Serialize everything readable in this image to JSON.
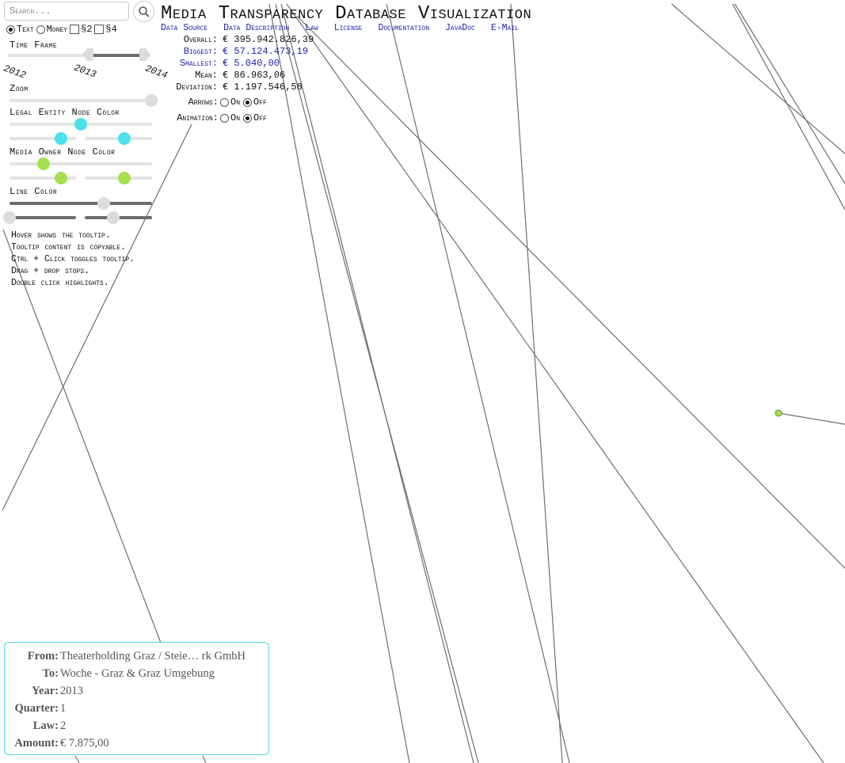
{
  "search": {
    "placeholder": "Search..."
  },
  "mode": {
    "text_label": "Text",
    "money_label": "Money",
    "para2_label": "§2",
    "para4_label": "§4",
    "selected": "text"
  },
  "sidebar": {
    "time_frame_label": "Time Frame",
    "years": [
      "2012",
      "2013",
      "2014"
    ],
    "zoom_label": "Zoom",
    "legal_entity_label": "Legal Entity Node Color",
    "media_owner_label": "Media Owner Node Color",
    "line_color_label": "Line Color",
    "colors": {
      "legal_entity": "#4be0ea",
      "media_owner": "#a6e04f",
      "slider_grey": "#dcdcdc",
      "line": "#6e6e6e"
    },
    "help_lines": [
      "Hover shows the tooltip.",
      "Tooltip content is copyable.",
      "Ctrl + Click toggles tooltip.",
      "Drag + drop stops.",
      "Double click highlights."
    ]
  },
  "header": {
    "title": "Media Transparency Database Visualization",
    "nav": [
      "Data Source",
      "Data Description",
      "Law",
      "License",
      "Documentation",
      "JavaDoc",
      "E-Mail"
    ]
  },
  "stats": {
    "overall_label": "Overall:",
    "overall_value": "€ 395.942.826,39",
    "biggest_label": "Biggest:",
    "biggest_value": "€ 57.124.473,19",
    "smallest_label": "Smallest:",
    "smallest_value": "€ 5.040,00",
    "mean_label": "Mean:",
    "mean_value": "€ 86.963,06",
    "deviation_label": "Deviation:",
    "deviation_value": "€ 1.197.546,58"
  },
  "options": {
    "arrows_label": "Arrows:",
    "animation_label": "Animation:",
    "on_label": "On",
    "off_label": "Off",
    "arrows_selected": "off",
    "animation_selected": "off"
  },
  "tooltip": {
    "from_label": "From:",
    "from_value": "Theaterholding Graz / Steie… rk GmbH",
    "to_label": "To:",
    "to_value": "Woche - Graz & Graz Umgebung",
    "year_label": "Year:",
    "year_value": "2013",
    "quarter_label": "Quarter:",
    "quarter_value": "1",
    "law_label": "Law:",
    "law_value": "2",
    "amount_label": "Amount:",
    "amount_value": "€ 7.875,00",
    "border_color": "#4fd9e6"
  }
}
